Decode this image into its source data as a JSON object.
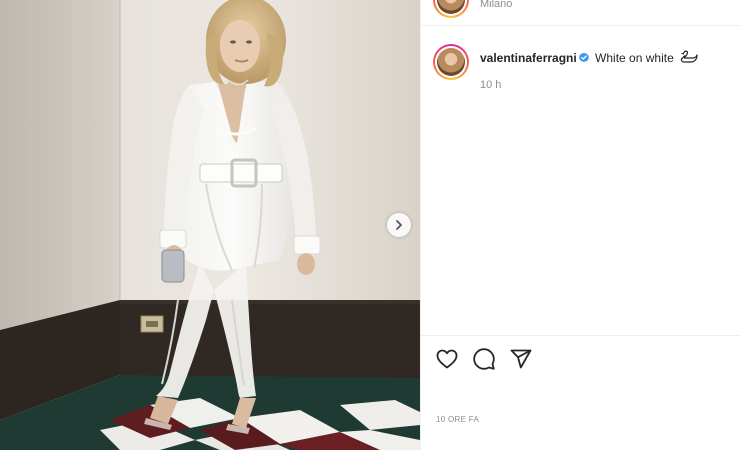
{
  "post": {
    "location": "Milano",
    "username": "valentinaferragni",
    "caption": "White on white",
    "time_ago": "10 h",
    "posted_ago": "10 ORE FA"
  },
  "icons": {
    "next": "chevron-right-icon",
    "like": "heart-icon",
    "comment": "comment-icon",
    "share": "paper-plane-icon",
    "verified": "verified-badge-icon",
    "caption_emoji": "swan-icon"
  },
  "colors": {
    "verified_blue": "#3897f0",
    "text_primary": "#262626",
    "text_secondary": "#8e8e8e",
    "divider": "#efefef"
  }
}
